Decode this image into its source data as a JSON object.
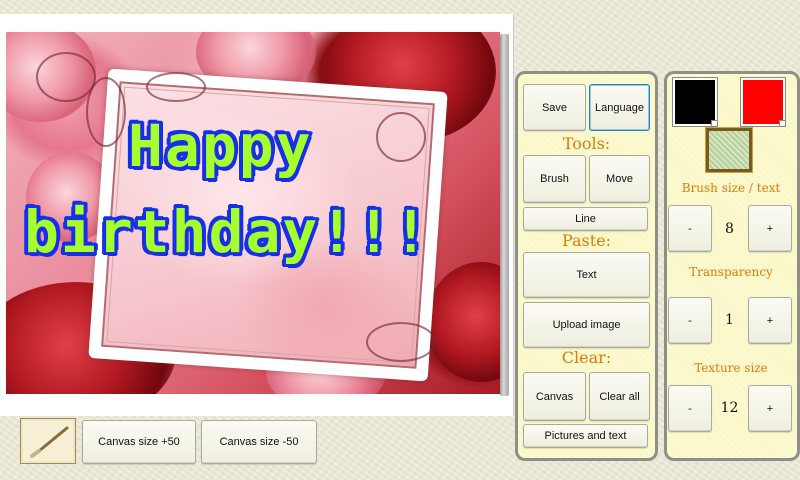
{
  "canvas": {
    "greeting_line1": "Happy",
    "greeting_line2": "birthday!!!"
  },
  "bottom_bar": {
    "canvas_plus_label": "Canvas size +50",
    "canvas_minus_label": "Canvas size -50"
  },
  "tools_panel": {
    "save_label": "Save",
    "language_label": "Language",
    "tools_heading": "Tools:",
    "brush_label": "Brush",
    "move_label": "Move",
    "line_label": "Line",
    "paste_heading": "Paste:",
    "text_label": "Text",
    "upload_label": "Upload image",
    "clear_heading": "Clear:",
    "clear_canvas_label": "Canvas",
    "clear_all_label": "Clear all",
    "clear_pictures_label": "Pictures and text"
  },
  "color_panel": {
    "primary_color": "#000000",
    "secondary_color": "#ff0000",
    "brush_size_label": "Brush size / text",
    "brush_size_value": "8",
    "transparency_label": "Transparency",
    "transparency_value": "1",
    "texture_size_label": "Texture size",
    "texture_size_value": "12",
    "minus_label": "-",
    "plus_label": "+"
  },
  "colors": {
    "panel_bg": "#faf8c6",
    "heading_orange": "#e07a08",
    "greeting_fill": "#a6ff2c",
    "greeting_outline": "#1530e8"
  }
}
